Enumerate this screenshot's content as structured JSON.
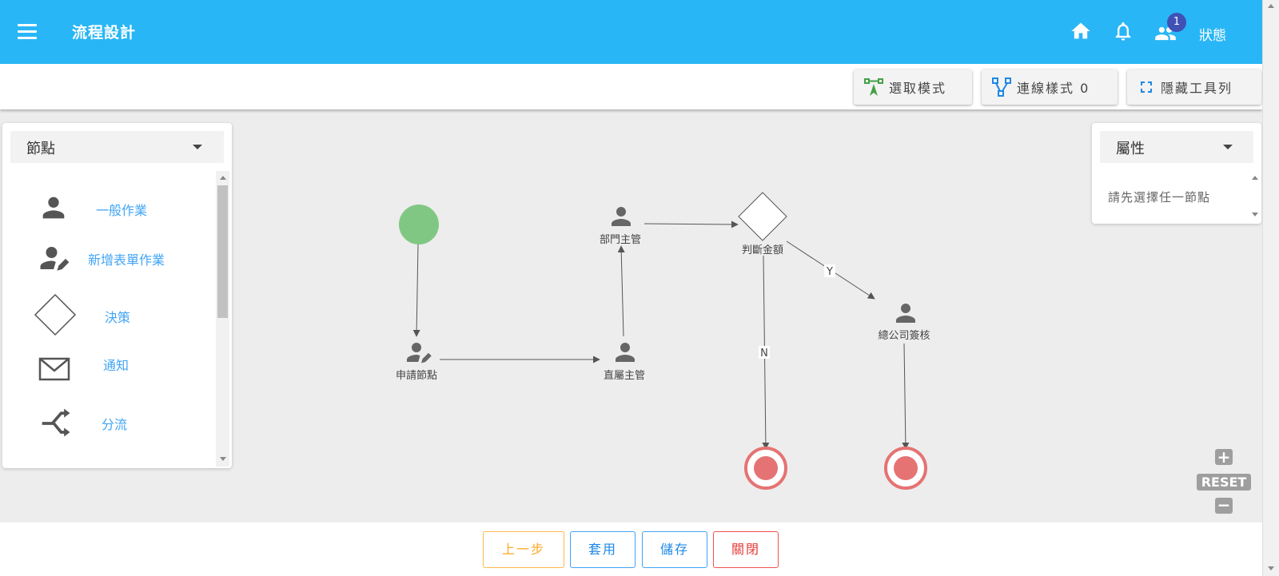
{
  "header": {
    "title": "流程設計",
    "notification_count": "1",
    "status_label": "狀態"
  },
  "toolbar": {
    "select_mode": "選取模式",
    "link_style": "連線樣式 0",
    "hide_toolbar": "隱藏工具列"
  },
  "left_panel": {
    "title": "節點",
    "items": [
      {
        "label": "一般作業",
        "icon": "person-icon"
      },
      {
        "label": "新增表單作業",
        "icon": "person-edit-icon"
      },
      {
        "label": "決策",
        "icon": "diamond-icon"
      },
      {
        "label": "通知",
        "icon": "mail-icon"
      },
      {
        "label": "分流",
        "icon": "shuffle-icon"
      }
    ]
  },
  "right_panel": {
    "title": "屬性",
    "placeholder": "請先選擇任一節點"
  },
  "diagram": {
    "nodes": {
      "apply": "申請節點",
      "direct_manager": "直屬主管",
      "dept_manager": "部門主管",
      "decision": "判斷金額",
      "hq_review": "總公司簽核"
    },
    "edge_labels": {
      "yes": "Y",
      "no": "N"
    }
  },
  "zoom": {
    "reset": "RESET"
  },
  "footer": {
    "prev": "上一步",
    "apply": "套用",
    "save": "儲存",
    "close": "關閉"
  },
  "colors": {
    "header": "#29b6f6",
    "start": "#81c784",
    "end": "#e57373",
    "link": "#42a5f5"
  }
}
